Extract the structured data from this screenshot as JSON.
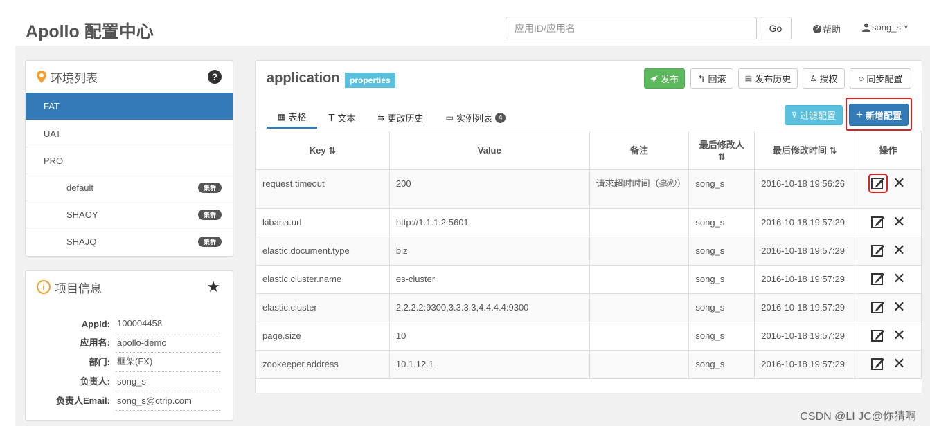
{
  "header": {
    "brand": "Apollo 配置中心",
    "search_placeholder": "应用ID/应用名",
    "go_label": "Go",
    "help_label": "帮助",
    "user_label": "song_s",
    "user_caret": "▾"
  },
  "env_panel": {
    "title": "环境列表",
    "help_glyph": "?",
    "items": [
      {
        "label": "FAT",
        "active": true
      },
      {
        "label": "UAT"
      },
      {
        "label": "PRO"
      },
      {
        "label": "default",
        "badge": "集群"
      },
      {
        "label": "SHAOY",
        "badge": "集群"
      },
      {
        "label": "SHAJQ",
        "badge": "集群"
      }
    ]
  },
  "info_panel": {
    "title": "项目信息",
    "rows": [
      {
        "key": "AppId:",
        "value": "100004458"
      },
      {
        "key": "应用名:",
        "value": "apollo-demo"
      },
      {
        "key": "部门:",
        "value": "框架(FX)"
      },
      {
        "key": "负责人:",
        "value": "song_s"
      },
      {
        "key": "负责人Email:",
        "value": "song_s@ctrip.com"
      }
    ]
  },
  "namespace": {
    "name": "application",
    "format_badge": "properties",
    "buttons": {
      "publish": "发布",
      "rollback": "回滚",
      "history": "发布历史",
      "grant": "授权",
      "sync": "同步配置",
      "filter": "过滤配置",
      "add": "新增配置"
    },
    "tabs": [
      {
        "label": "表格",
        "icon": "table-icon"
      },
      {
        "label": "文本",
        "icon": "text-icon"
      },
      {
        "label": "更改历史",
        "icon": "history-icon"
      },
      {
        "label": "实例列表",
        "icon": "instance-icon",
        "count": "4"
      }
    ]
  },
  "table": {
    "headers": {
      "key": "Key",
      "value": "Value",
      "comment": "备注",
      "modifier_line1": "最后修改人",
      "modifier_line2": "",
      "modified_time": "最后修改时间",
      "ops": "操作"
    },
    "rows": [
      {
        "key": "request.timeout",
        "value": "200",
        "comment": "请求超时时间（毫秒）",
        "modifier": "song_s",
        "time": "2016-10-18 19:56:26"
      },
      {
        "key": "kibana.url",
        "value": "http://1.1.1.2:5601",
        "comment": "",
        "modifier": "song_s",
        "time": "2016-10-18 19:57:29"
      },
      {
        "key": "elastic.document.type",
        "value": "biz",
        "comment": "",
        "modifier": "song_s",
        "time": "2016-10-18 19:57:29"
      },
      {
        "key": "elastic.cluster.name",
        "value": "es-cluster",
        "comment": "",
        "modifier": "song_s",
        "time": "2016-10-18 19:57:29"
      },
      {
        "key": "elastic.cluster",
        "value": "2.2.2.2:9300,3.3.3.3,4.4.4.4:9300",
        "comment": "",
        "modifier": "song_s",
        "time": "2016-10-18 19:57:29"
      },
      {
        "key": "page.size",
        "value": "10",
        "comment": "",
        "modifier": "song_s",
        "time": "2016-10-18 19:57:29"
      },
      {
        "key": "zookeeper.address",
        "value": "10.1.12.1",
        "comment": "",
        "modifier": "song_s",
        "time": "2016-10-18 19:57:29"
      }
    ]
  },
  "watermark": "CSDN @LI JC@你猜啊",
  "colors": {
    "primary": "#337ab7",
    "success": "#5cb85c",
    "info": "#5bc0de",
    "highlight": "#e02020"
  }
}
